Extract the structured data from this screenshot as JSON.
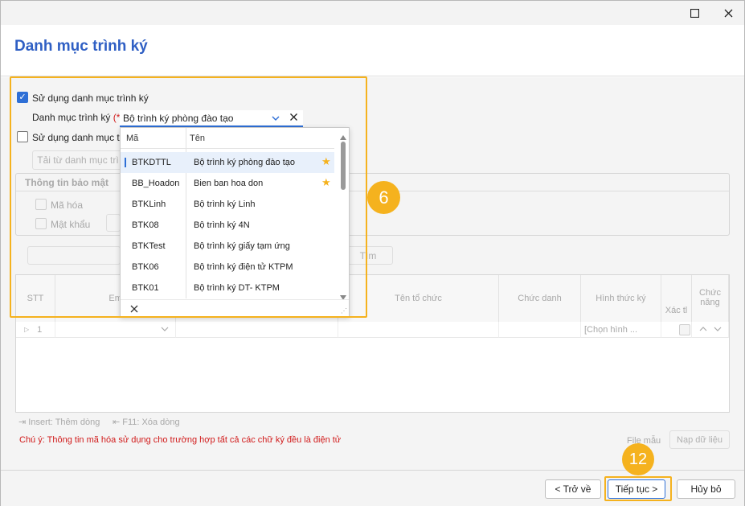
{
  "window": {
    "maximize_icon": "maximize-icon",
    "close_icon": "close-icon"
  },
  "header": {
    "title": "Danh mục trình ký"
  },
  "form": {
    "use_signing_list_label": "Sử dụng danh mục trình ký",
    "use_signing_list_checked": true,
    "signing_list_label": "Danh mục trình ký",
    "required_mark": "(*)",
    "signing_list_value": "Bộ trình ký phòng đào tạo",
    "use_second_label": "Sử dụng danh mục tr",
    "load_list_button": "Tải từ danh mục trì",
    "security_group_title": "Thông tin bảo mật",
    "encrypt_label": "Mã hóa",
    "password_label": "Mật khẩu",
    "search_button": "Tìm"
  },
  "dropdown": {
    "columns": [
      "Mã",
      "Tên"
    ],
    "rows": [
      {
        "code": "BTKDTTL",
        "name": "Bộ trình ký phòng đào tạo",
        "starred": true,
        "selected": true
      },
      {
        "code": "BB_Hoadon",
        "name": "Bien ban hoa don",
        "starred": true,
        "selected": false
      },
      {
        "code": "BTKLinh",
        "name": "Bộ trình ký Linh",
        "starred": false,
        "selected": false
      },
      {
        "code": "BTK08",
        "name": "Bộ trình ký 4N",
        "starred": false,
        "selected": false
      },
      {
        "code": "BTKTest",
        "name": "Bộ trình ký giấy tạm ứng",
        "starred": false,
        "selected": false
      },
      {
        "code": "BTK06",
        "name": "Bộ trình ký điện tử KTPM",
        "starred": false,
        "selected": false
      },
      {
        "code": "BTK01",
        "name": "Bộ trình ký DT- KTPM",
        "starred": false,
        "selected": false
      }
    ]
  },
  "grid": {
    "headers": {
      "stt": "STT",
      "email": "Ema",
      "org": "Tên tổ chức",
      "title": "Chức danh",
      "method": "Hình thức ký",
      "confirm": "Xác tl",
      "function": "Chức năng"
    },
    "row1": {
      "index": "1",
      "method": "[Chọn hình ..."
    }
  },
  "hints": {
    "insert": "Insert: Thêm dòng",
    "delete": "F11: Xóa dòng",
    "note": "Chú ý: Thông tin mã hóa sử dụng cho trường hợp tất cả các chữ ký đều là điện tử",
    "file_sample": "File mẫu",
    "import_button": "Nạp dữ liệu"
  },
  "footer": {
    "back_button": "< Trở về",
    "next_button": "Tiếp tục >",
    "cancel_button": "Hủy bỏ"
  },
  "annotations": {
    "badge_6": "6",
    "badge_12": "12"
  },
  "colors": {
    "accent": "#2e6fd6",
    "title": "#2f5fc4",
    "highlight": "#f5b21e",
    "warning": "#d11a1a"
  }
}
